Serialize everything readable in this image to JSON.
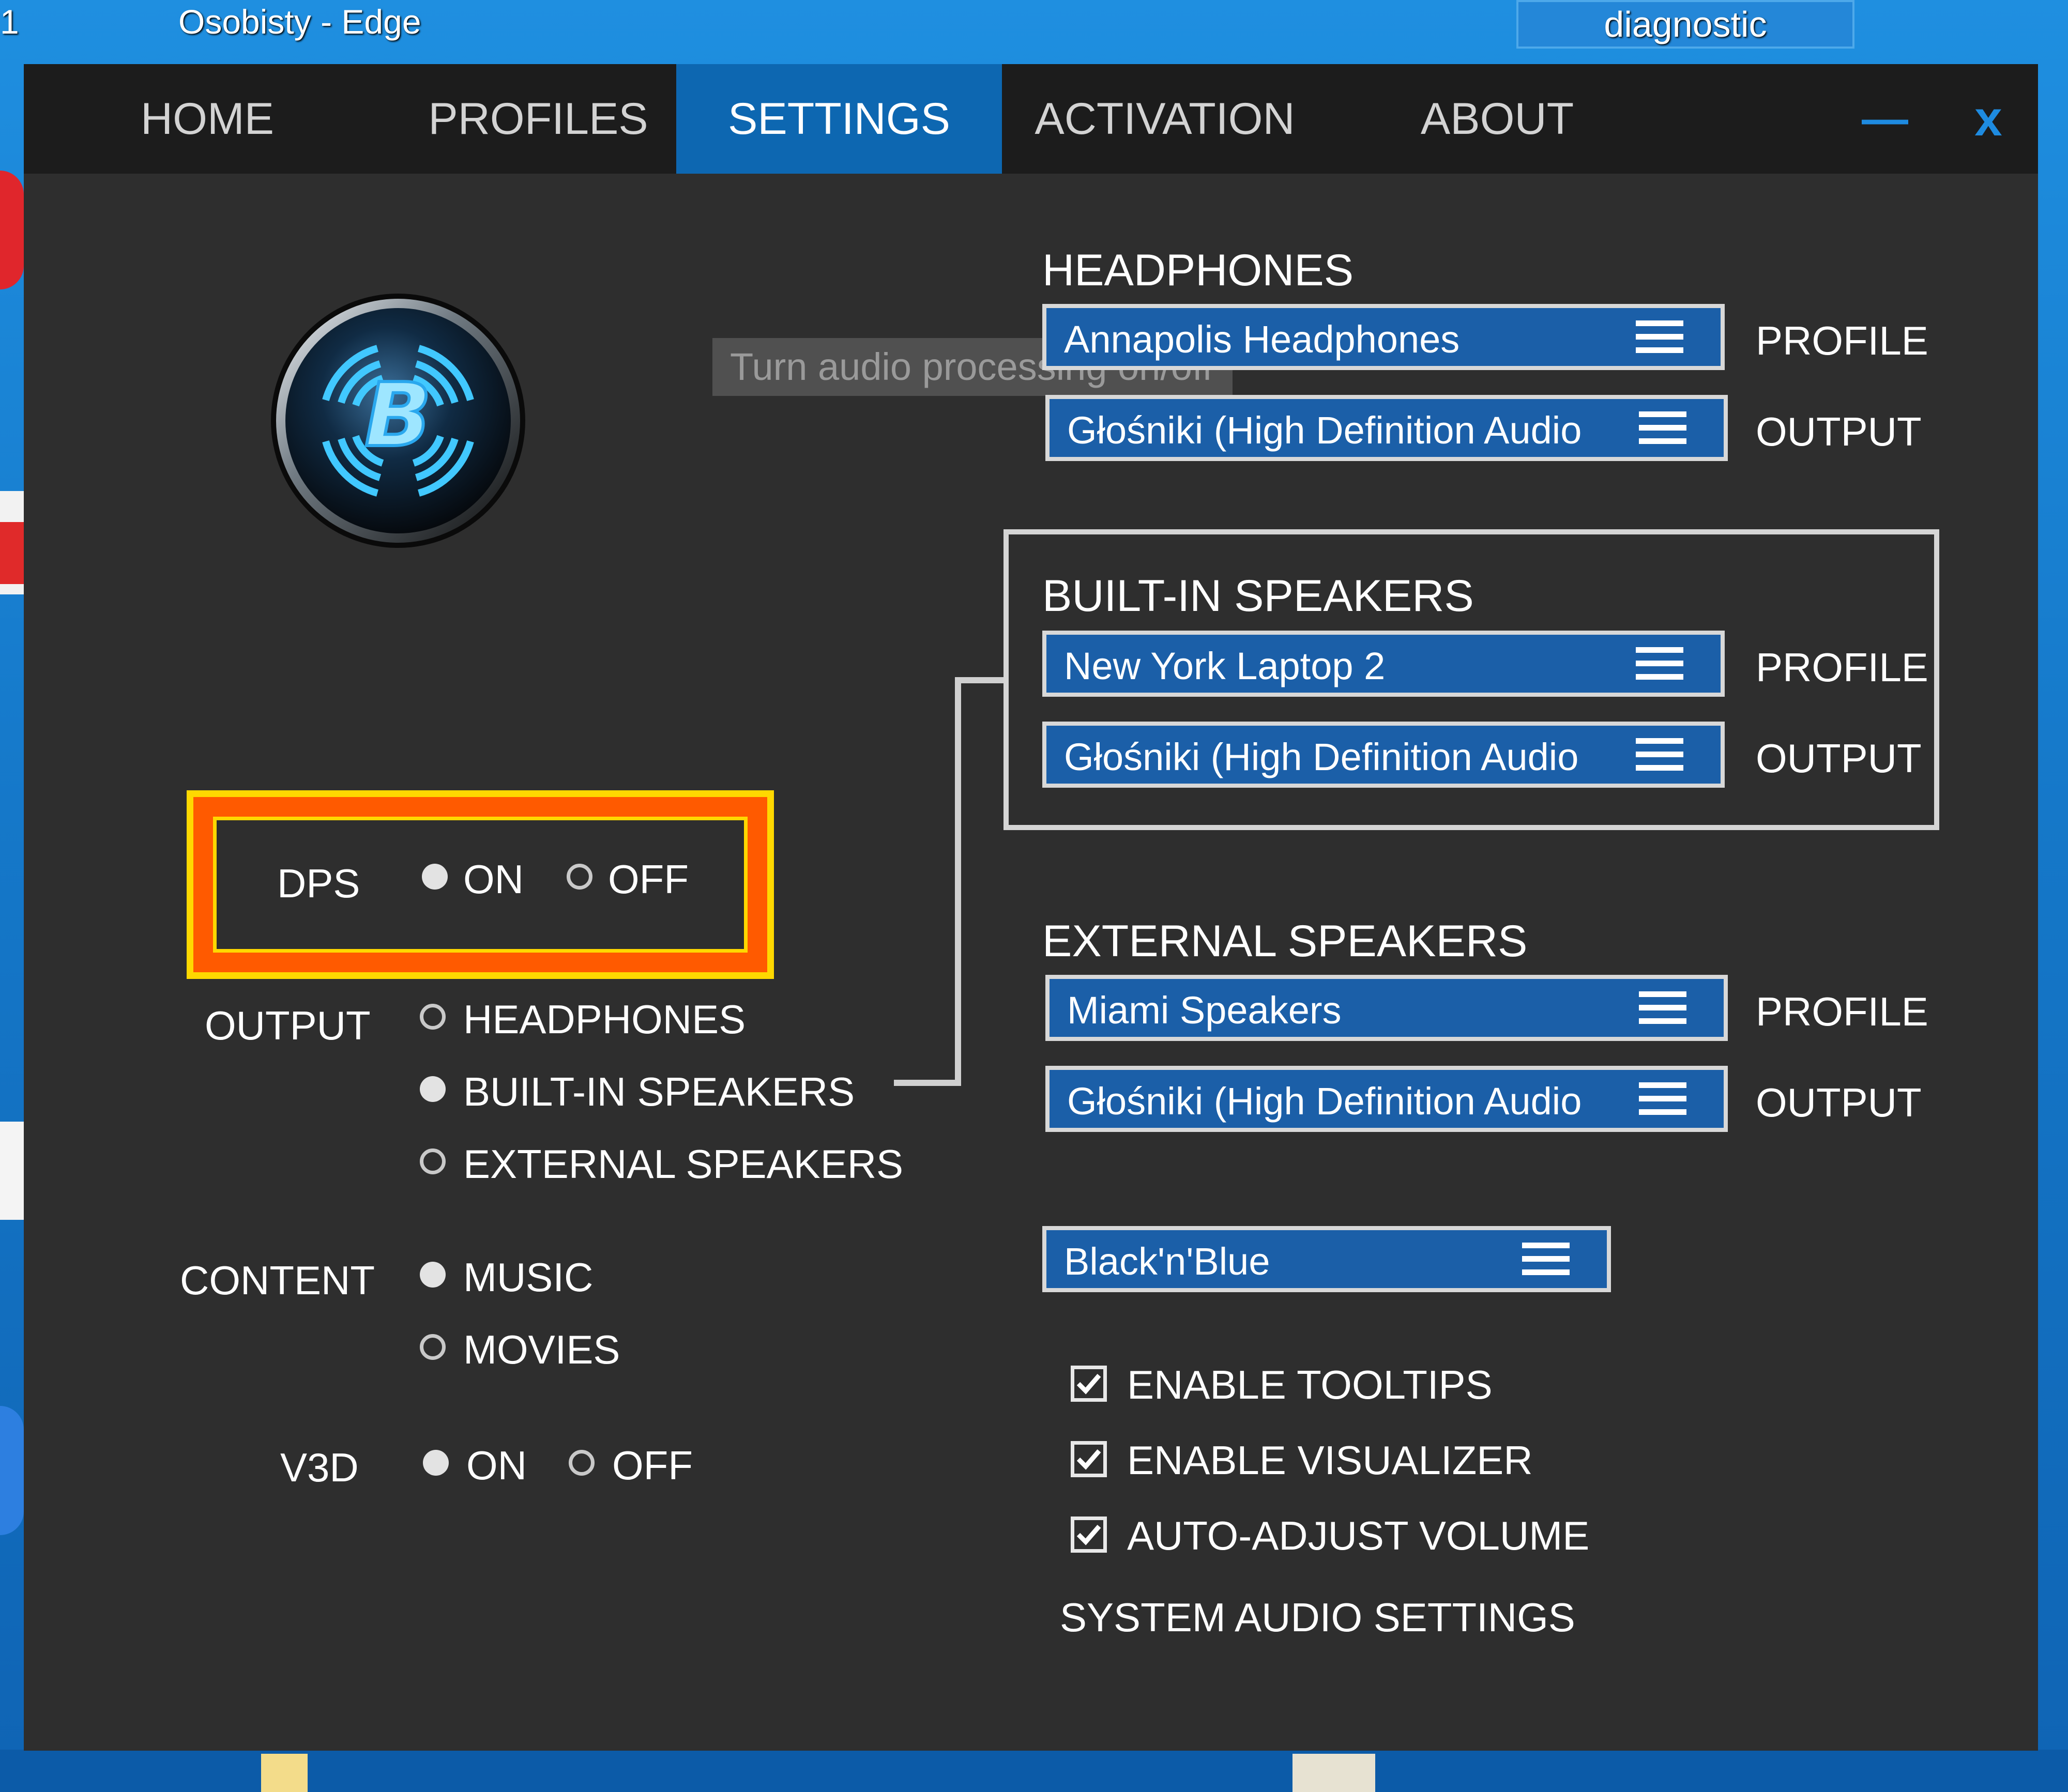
{
  "desktop": {
    "window_title": "Osobisty - Edge",
    "corner_number": "1",
    "diagnostic_label": "diagnostic"
  },
  "nav": {
    "tabs": [
      {
        "label": "HOME"
      },
      {
        "label": "PROFILES"
      },
      {
        "label": "SETTINGS",
        "active": true
      },
      {
        "label": "ACTIVATION"
      },
      {
        "label": "ABOUT"
      }
    ],
    "minimize_label": "—",
    "close_label": "x"
  },
  "logo": {
    "icon": "b-logo-icon",
    "tooltip": "Turn audio processing on/off"
  },
  "dps": {
    "label": "DPS",
    "on_label": "ON",
    "off_label": "OFF",
    "value": "ON"
  },
  "output": {
    "label": "OUTPUT",
    "options": [
      "HEADPHONES",
      "BUILT-IN SPEAKERS",
      "EXTERNAL SPEAKERS"
    ],
    "selected": "BUILT-IN SPEAKERS"
  },
  "content": {
    "label": "CONTENT",
    "options": [
      "MUSIC",
      "MOVIES"
    ],
    "selected": "MUSIC"
  },
  "v3d": {
    "label": "V3D",
    "on_label": "ON",
    "off_label": "OFF",
    "value": "ON"
  },
  "headphones": {
    "title": "HEADPHONES",
    "profile_value": "Annapolis Headphones",
    "profile_label": "PROFILE",
    "output_value": "Głośniki (High Definition Audio",
    "output_label": "OUTPUT"
  },
  "builtin": {
    "title": "BUILT-IN SPEAKERS",
    "profile_value": "New York Laptop 2",
    "profile_label": "PROFILE",
    "output_value": "Głośniki (High Definition Audio",
    "output_label": "OUTPUT"
  },
  "external": {
    "title": "EXTERNAL SPEAKERS",
    "profile_value": "Miami Speakers",
    "profile_label": "PROFILE",
    "output_value": "Głośniki (High Definition Audio",
    "output_label": "OUTPUT"
  },
  "skin": {
    "value": "Black'n'Blue"
  },
  "options": {
    "tooltips": "ENABLE TOOLTIPS",
    "visualizer": "ENABLE VISUALIZER",
    "auto_volume": "AUTO-ADJUST VOLUME",
    "checked": [
      true,
      true,
      true
    ]
  },
  "system_audio_link": "SYSTEM AUDIO SETTINGS",
  "colors": {
    "accent": "#0d67b1",
    "highlight_outer": "#ff5a00",
    "highlight_inner": "#ffd800"
  }
}
